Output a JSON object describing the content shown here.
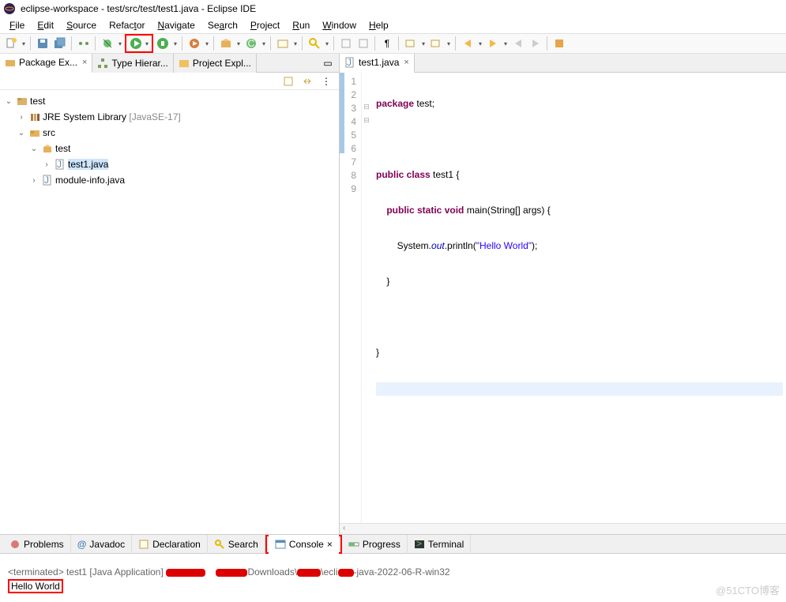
{
  "title": "eclipse-workspace - test/src/test/test1.java - Eclipse IDE",
  "menu": {
    "file": "File",
    "edit": "Edit",
    "source": "Source",
    "refactor": "Refactor",
    "navigate": "Navigate",
    "search": "Search",
    "project": "Project",
    "run": "Run",
    "window": "Window",
    "help": "Help"
  },
  "left_tabs": {
    "package_explorer": "Package Ex...",
    "type_hierarchy": "Type Hierar...",
    "project_explorer": "Project Expl..."
  },
  "tree": {
    "project": "test",
    "jre": "JRE System Library",
    "jre_suffix": "[JavaSE-17]",
    "src": "src",
    "package": "test",
    "file1": "test1.java",
    "file2": "module-info.java"
  },
  "editor": {
    "tab": "test1.java",
    "lines": [
      "1",
      "2",
      "3",
      "4",
      "5",
      "6",
      "7",
      "8",
      "9"
    ],
    "code": {
      "l1_a": "package",
      "l1_b": " test;",
      "l3_a": "public class",
      "l3_b": " test1 {",
      "l4_a": "public static void",
      "l4_b": " main(String[] args) {",
      "l5_a": "System.",
      "l5_out": "out",
      "l5_b": ".println(",
      "l5_str": "\"Hello World\"",
      "l5_c": ");",
      "l6": "    }",
      "l8": "}"
    }
  },
  "bottom_tabs": {
    "problems": "Problems",
    "javadoc": "Javadoc",
    "declaration": "Declaration",
    "search": "Search",
    "console": "Console",
    "progress": "Progress",
    "terminal": "Terminal"
  },
  "console": {
    "status_prefix": "<terminated> test1 [Java Application] ",
    "status_mid": "Downloads\\",
    "status_suffix": "-java-2022-06-R-win32",
    "output": "Hello World"
  },
  "watermark": "@51CTO博客"
}
